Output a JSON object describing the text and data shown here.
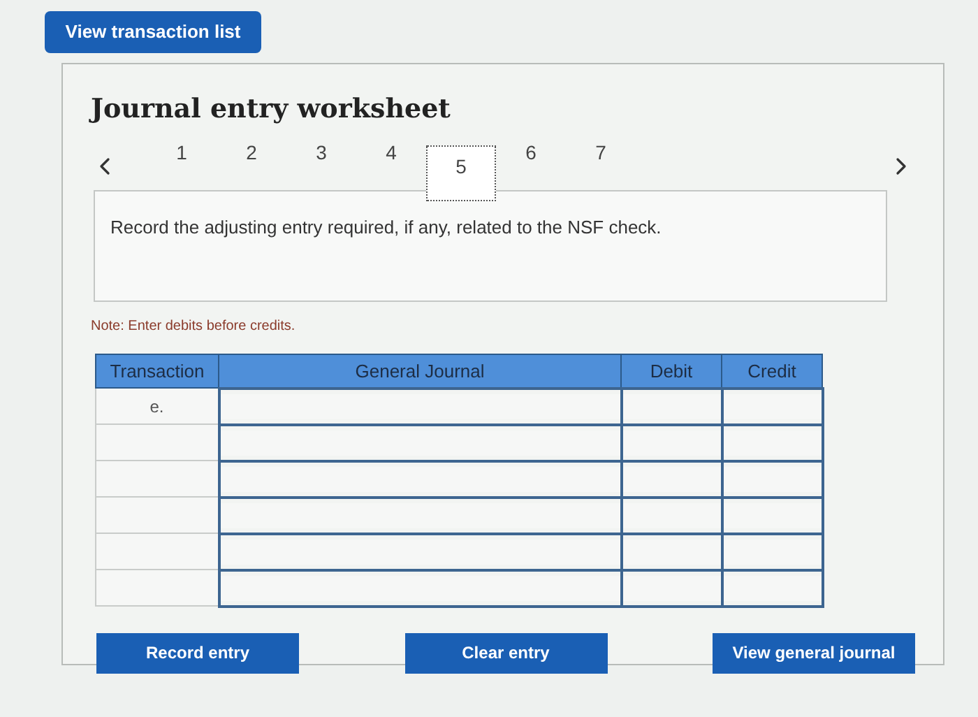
{
  "top_button": "View transaction list",
  "worksheet": {
    "title": "Journal entry worksheet",
    "tabs": [
      {
        "label": "1",
        "selected": false
      },
      {
        "label": "2",
        "selected": false
      },
      {
        "label": "3",
        "selected": false
      },
      {
        "label": "4",
        "selected": false
      },
      {
        "label": "5",
        "selected": true
      },
      {
        "label": "6",
        "selected": false
      },
      {
        "label": "7",
        "selected": false
      }
    ],
    "prompt": "Record the adjusting entry required, if any, related to the NSF check.",
    "note": "Note: Enter debits before credits.",
    "table": {
      "columns": [
        "Transaction",
        "General Journal",
        "Debit",
        "Credit"
      ],
      "rows": [
        {
          "transaction": "e."
        },
        {},
        {},
        {},
        {},
        {}
      ]
    },
    "buttons": [
      "Record entry",
      "Clear entry",
      "View general journal"
    ]
  }
}
